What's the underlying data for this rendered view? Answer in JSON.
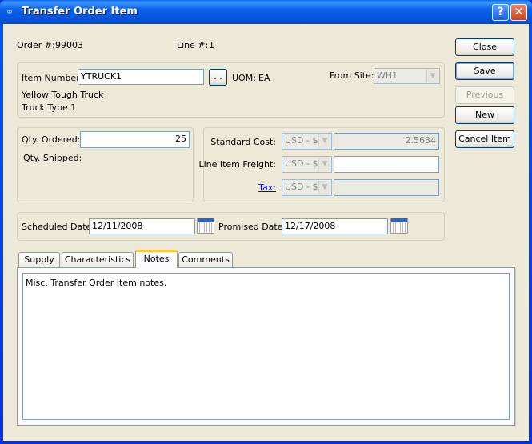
{
  "window": {
    "title": "Transfer Order Item",
    "help_label": "?",
    "close_label": "✕"
  },
  "header": {
    "order_label": "Order #:",
    "order_value": "99003",
    "line_label": "Line #:",
    "line_value": "1"
  },
  "item": {
    "item_number_label": "Item Number:",
    "item_number_value": "YTRUCK1",
    "browse_label": "...",
    "uom_label": "UOM:",
    "uom_value": "EA",
    "from_site_label": "From Site:",
    "from_site_value": "WH1",
    "description1": "Yellow Tough Truck",
    "description2": "Truck Type 1"
  },
  "qty": {
    "ordered_label": "Qty. Ordered:",
    "ordered_value": "25",
    "shipped_label": "Qty. Shipped:"
  },
  "costs": {
    "standard_cost_label": "Standard Cost:",
    "standard_cost_currency": "USD - $",
    "standard_cost_value": "2.5634",
    "freight_label": "Line Item Freight:",
    "freight_currency": "USD - $",
    "freight_value": "",
    "tax_label": "Tax:",
    "tax_currency": "USD - $",
    "tax_value": ""
  },
  "dates": {
    "scheduled_label": "Scheduled Date:",
    "scheduled_value": "12/11/2008",
    "promised_label": "Promised Date:",
    "promised_value": "12/17/2008"
  },
  "buttons": {
    "close": "Close",
    "save": "Save",
    "previous": "Previous",
    "new": "New",
    "cancel_item": "Cancel Item"
  },
  "tabs": [
    {
      "label": "Supply"
    },
    {
      "label": "Characteristics"
    },
    {
      "label": "Notes",
      "selected": true
    },
    {
      "label": "Comments"
    }
  ],
  "notes": {
    "text": "Misc. Transfer Order Item notes."
  },
  "colors": {
    "title_bar": "#0a5fe8",
    "client_bg": "#ece9d8",
    "link": "#0000ff",
    "tab_selected_accent": "#ffc83c"
  }
}
